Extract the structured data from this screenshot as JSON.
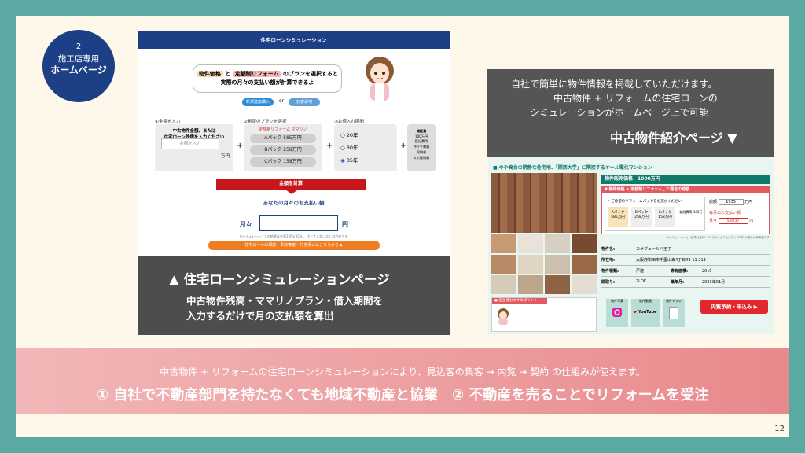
{
  "badge": {
    "number": "2",
    "line1": "施工店専用",
    "line2": "ホームページ"
  },
  "sim": {
    "header": "住宅ローンシミュレーション",
    "intro_pill1": "物件価格",
    "intro_mid": "と",
    "intro_pill2": "定額制リフォーム",
    "intro_rest": "のプランを選択すると",
    "intro_line2": "実際の月々の支払い額が計算できるよ",
    "tag1": "新規建築購入",
    "tag2": "お客様宅",
    "col1_label": "①金額を入力",
    "col1_text1": "中古物件金額、または",
    "col1_text2": "住宅ローン残債を入力ください",
    "col1_placeholder": "金額を入力",
    "col1_unit": "万円",
    "col2_label": "②希望のプランを選択",
    "col2_brand": "定額制リフォーム ママリノ",
    "plans": [
      "Aパック 585万円",
      "Bパック 258万円",
      "Cパック 158万円"
    ],
    "col3_label": "③お借入れ期間",
    "terms": [
      "20年",
      "30年",
      "35年"
    ],
    "side_box": [
      "諸経費",
      "100万円",
      "登記費用",
      "仲介手数料",
      "保険料",
      "火災保険料"
    ],
    "calc_btn": "金額を計算",
    "result_label": "あなたの月々のお支払い額",
    "result_prefix": "月々",
    "result_unit": "円",
    "note": "※シミュレーションの結果は金利1.0%(35年)、ボーナス払いなしの目安です",
    "consult_btn": "住宅ローンの相談・事前審査・付き添いはこちらから ▶"
  },
  "caption_left": {
    "title": "▲ 住宅ローンシミュレーションページ",
    "line1": "中古物件残高・ママリノプラン・借入期間を",
    "line2": "入力するだけで月の支払額を算出"
  },
  "caption_right": {
    "line1": "自社で簡単に物件情報を掲載していただけます。",
    "line2": "中古物件 + リフォームの住宅ローンの",
    "line3": "シミュレーションがホームページ上で可能",
    "title": "中古物件紹介ページ ▼"
  },
  "property": {
    "heading": "■ やや高台の閑静な住宅地、「関西大学」に隣接するオール電化マンション",
    "price": "物件販売価格：1000万円",
    "plan_title": "▼ 物件価格 + 定額制リフォームした場合の総額",
    "plan_q": "✓ ご希望のリフォームパックをお選びください",
    "packs": [
      {
        "name": "Aパック",
        "price": "585万円"
      },
      {
        "name": "Bパック",
        "price": "258万円"
      },
      {
        "name": "Cパック",
        "price": "158万円"
      }
    ],
    "extra": "諸経費等 100万",
    "total_label": "総額",
    "total_value": "1935",
    "total_unit": "万円",
    "monthly_title": "毎月のお支払い額",
    "monthly_prefix": "月々",
    "monthly_value": "52837",
    "monthly_unit": "円",
    "fine": "※シミュレーション結果は金利1.0%でボーナス払いなし(35年)の場合の参考値です",
    "info": [
      {
        "k": "物件名:",
        "v": "カサブェール八王子",
        "k2": "",
        "v2": ""
      },
      {
        "k": "所在地:",
        "v": "大阪府吹田市千里山東4丁目43-11 213",
        "k2": "",
        "v2": ""
      },
      {
        "k": "物件種類:",
        "v": "戸建",
        "k2": "専有面積:",
        "v2": "20㎡"
      },
      {
        "k": "間取り:",
        "v": "2LDK",
        "k2": "築年月:",
        "v2": "2023年01月"
      }
    ],
    "point_label": "● 担当者おすすめポイント",
    "sns": [
      "物件写真",
      "物件動画",
      "物件チラシ"
    ],
    "youtube": "YouTube",
    "reserve_btn": "内覧予約・申込み ▶"
  },
  "banner": {
    "line1": "中古物件 + リフォームの住宅ローンシミュレーションにより、見込客の集客 → 内覧 → 契約 の仕組みが使えます。",
    "line2": "① 自社で不動産部門を持たなくても地域不動産と協業　② 不動産を売ることでリフォームを受注"
  },
  "page_number": "12"
}
